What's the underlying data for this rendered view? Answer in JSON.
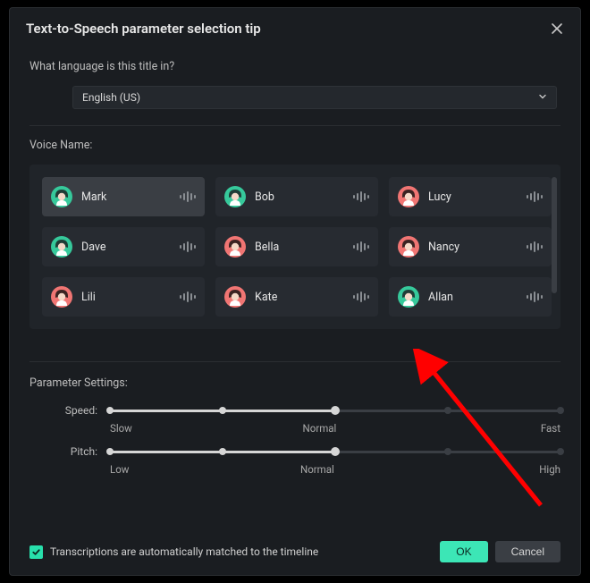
{
  "title": "Text-to-Speech parameter selection tip",
  "language_question": "What language is this title in?",
  "language_value": "English (US)",
  "voice_label": "Voice Name:",
  "voices": [
    {
      "name": "Mark",
      "gender": "m",
      "selected": true
    },
    {
      "name": "Bob",
      "gender": "m",
      "selected": false
    },
    {
      "name": "Lucy",
      "gender": "f",
      "selected": false
    },
    {
      "name": "Dave",
      "gender": "m",
      "selected": false
    },
    {
      "name": "Bella",
      "gender": "f",
      "selected": false
    },
    {
      "name": "Nancy",
      "gender": "f",
      "selected": false
    },
    {
      "name": "Lili",
      "gender": "f",
      "selected": false
    },
    {
      "name": "Kate",
      "gender": "f",
      "selected": false
    },
    {
      "name": "Allan",
      "gender": "m",
      "selected": false
    }
  ],
  "params_label": "Parameter Settings:",
  "speed": {
    "label": "Speed:",
    "ticks": [
      "Slow",
      "Normal",
      "Fast"
    ],
    "value": 0.5
  },
  "pitch": {
    "label": "Pitch:",
    "ticks": [
      "Low",
      "Normal",
      "High"
    ],
    "value": 0.5
  },
  "transcription_label": "Transcriptions are automatically matched to the timeline",
  "transcription_checked": true,
  "ok_label": "OK",
  "cancel_label": "Cancel",
  "colors": {
    "accent": "#3ce6b6",
    "male_avatar": "#36c99b",
    "female_avatar": "#f07573"
  }
}
